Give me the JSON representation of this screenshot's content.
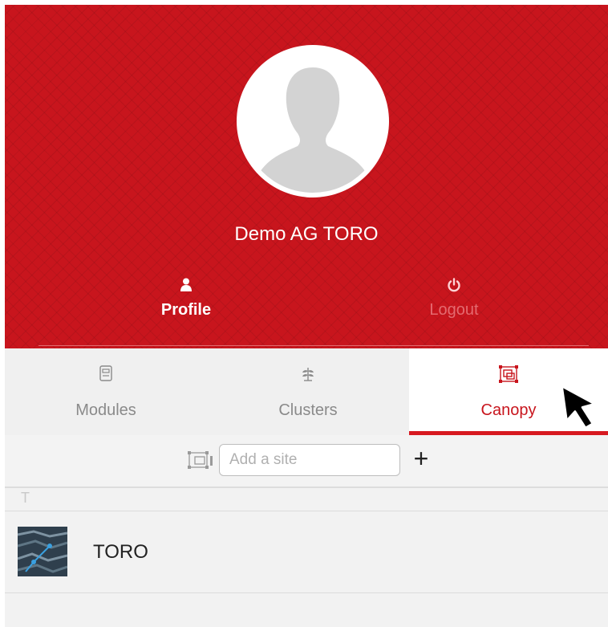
{
  "header": {
    "user_name": "Demo AG TORO",
    "profile_label": "Profile",
    "logout_label": "Logout",
    "accent_color": "#c8151d"
  },
  "tabs": [
    {
      "label": "Modules",
      "icon": "module-icon",
      "active": false
    },
    {
      "label": "Clusters",
      "icon": "plant-icon",
      "active": false
    },
    {
      "label": "Canopy",
      "icon": "canopy-frame-icon",
      "active": true
    }
  ],
  "add_site": {
    "placeholder": "Add a site",
    "value": "",
    "icon": "site-map-icon",
    "add_symbol": "+"
  },
  "site_list": {
    "section_letter": "T",
    "items": [
      {
        "label": "TORO",
        "thumbnail": "map-thumbnail-icon"
      }
    ]
  }
}
